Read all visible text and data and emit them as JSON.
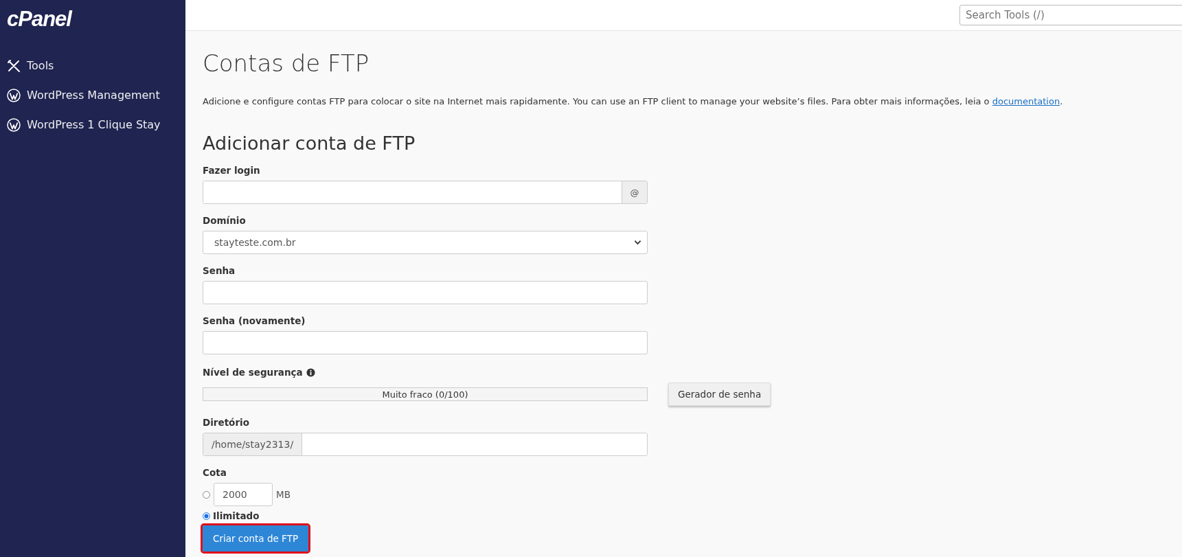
{
  "sidebar": {
    "logo": "cPanel",
    "items": [
      {
        "label": "Tools",
        "kind": "tools"
      },
      {
        "label": "WordPress Management",
        "kind": "wordpress"
      },
      {
        "label": "WordPress 1 Clique Stay",
        "kind": "wordpress"
      }
    ]
  },
  "search": {
    "placeholder": "Search Tools (/)"
  },
  "page": {
    "title": "Contas de FTP",
    "intro": "Adicione e configure contas FTP para colocar o site na Internet mais rapidamente. You can use an FTP client to manage your website’s files. Para obter mais informações, leia o",
    "intro_link": "documentation",
    "intro_end": "."
  },
  "form": {
    "heading": "Adicionar conta de FTP",
    "login": {
      "label": "Fazer login",
      "addon": "@"
    },
    "domain": {
      "label": "Domínio",
      "value": "stayteste.com.br"
    },
    "password": {
      "label": "Senha"
    },
    "password_again": {
      "label": "Senha (novamente)"
    },
    "strength": {
      "label": "Nível de segurança",
      "reading": "Muito fraco (0/100)",
      "generator_button": "Gerador de senha"
    },
    "directory": {
      "label": "Diretório",
      "prefix": "/home/stay2313/"
    },
    "quota": {
      "label": "Cota",
      "options": [
        {
          "kind": "amount",
          "value": "2000",
          "unit": "MB",
          "selected": false
        },
        {
          "kind": "unlimited",
          "label": "Ilimitado",
          "selected": true
        }
      ]
    },
    "submit": {
      "label": "Criar conta de FTP",
      "highlighted": true
    }
  }
}
